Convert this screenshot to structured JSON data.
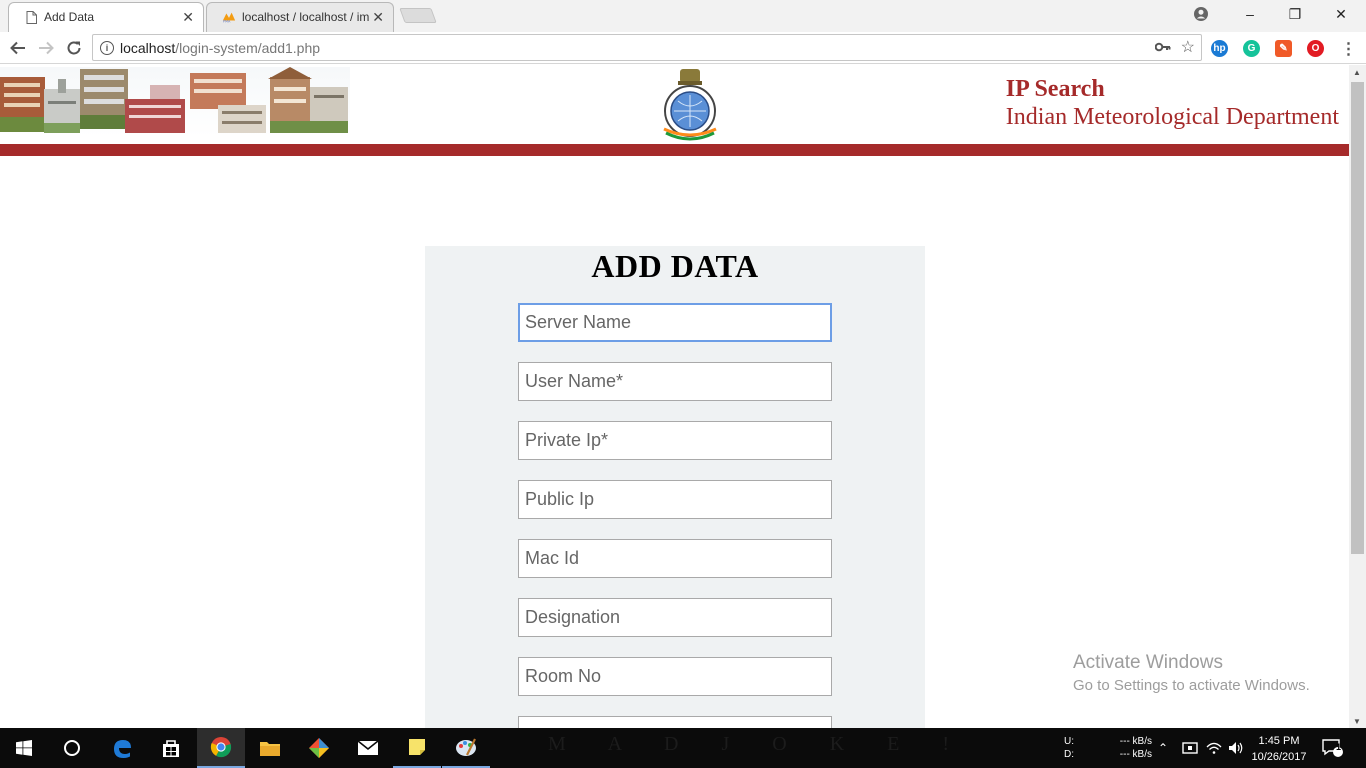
{
  "browser": {
    "tabs": [
      {
        "title": "Add Data",
        "icon": "page-icon",
        "active": true
      },
      {
        "title": "localhost / localhost / im",
        "icon": "phpmyadmin-icon",
        "active": false
      }
    ],
    "url": {
      "host": "localhost",
      "path": "/login-system/add1.php"
    },
    "window_controls": {
      "minimize": "–",
      "restore": "❐",
      "close": "✕"
    }
  },
  "header": {
    "title": "IP Search",
    "subtitle": "Indian Meteorological Department",
    "emblem_icon": "imd-emblem-icon",
    "accent_color": "#a52a2a"
  },
  "form": {
    "heading": "ADD DATA",
    "fields": [
      {
        "name": "server-name",
        "placeholder": "Server Name",
        "value": "",
        "focused": true
      },
      {
        "name": "user-name",
        "placeholder": "User Name*",
        "value": ""
      },
      {
        "name": "private-ip",
        "placeholder": "Private Ip*",
        "value": ""
      },
      {
        "name": "public-ip",
        "placeholder": "Public Ip",
        "value": ""
      },
      {
        "name": "mac-id",
        "placeholder": "Mac Id",
        "value": ""
      },
      {
        "name": "designation",
        "placeholder": "Designation",
        "value": ""
      },
      {
        "name": "room-no",
        "placeholder": "Room No",
        "value": ""
      }
    ]
  },
  "watermark": {
    "line1": "Activate Windows",
    "line2": "Go to Settings to activate Windows."
  },
  "taskbar": {
    "wallpaper_text": "M A D   J O K E !",
    "network": {
      "up_label": "U:",
      "down_label": "D:",
      "up_value": "--- kB/s",
      "down_value": "--- kB/s"
    },
    "time": "1:45 PM",
    "date": "10/26/2017",
    "notification_count": "1"
  }
}
